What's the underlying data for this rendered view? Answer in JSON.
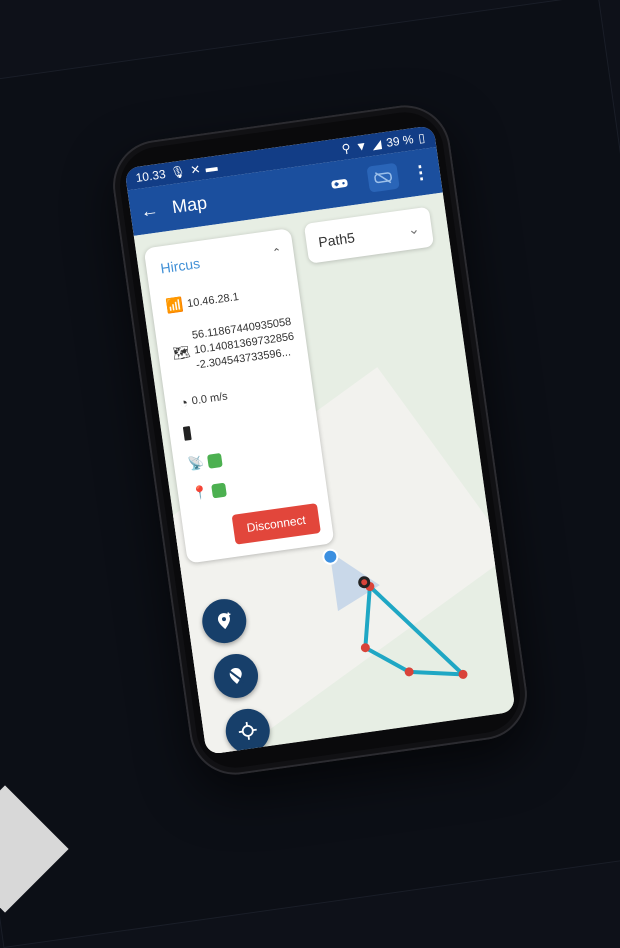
{
  "statusbar": {
    "time": "10.33",
    "battery": "39 %"
  },
  "appbar": {
    "title": "Map",
    "back_icon": "arrow-left-icon",
    "menu_icon": "more-vert-icon"
  },
  "path_select": {
    "value": "Path5"
  },
  "robot_panel": {
    "name": "Hircus",
    "ip": "10.46.28.1",
    "coordinates": [
      "56.11867440935058",
      "10.14081369732856",
      "-2.304543733596..."
    ],
    "speed": "0.0 m/s",
    "disconnect_label": "Disconnect"
  },
  "colors": {
    "appbar": "#1b4f9e",
    "statusbar": "#123d86",
    "path_line": "#1fa7c4",
    "waypoint": "#d9433a",
    "indicator_ok": "#4cb050",
    "disconnect": "#e2463b",
    "fab": "#173f6a"
  }
}
